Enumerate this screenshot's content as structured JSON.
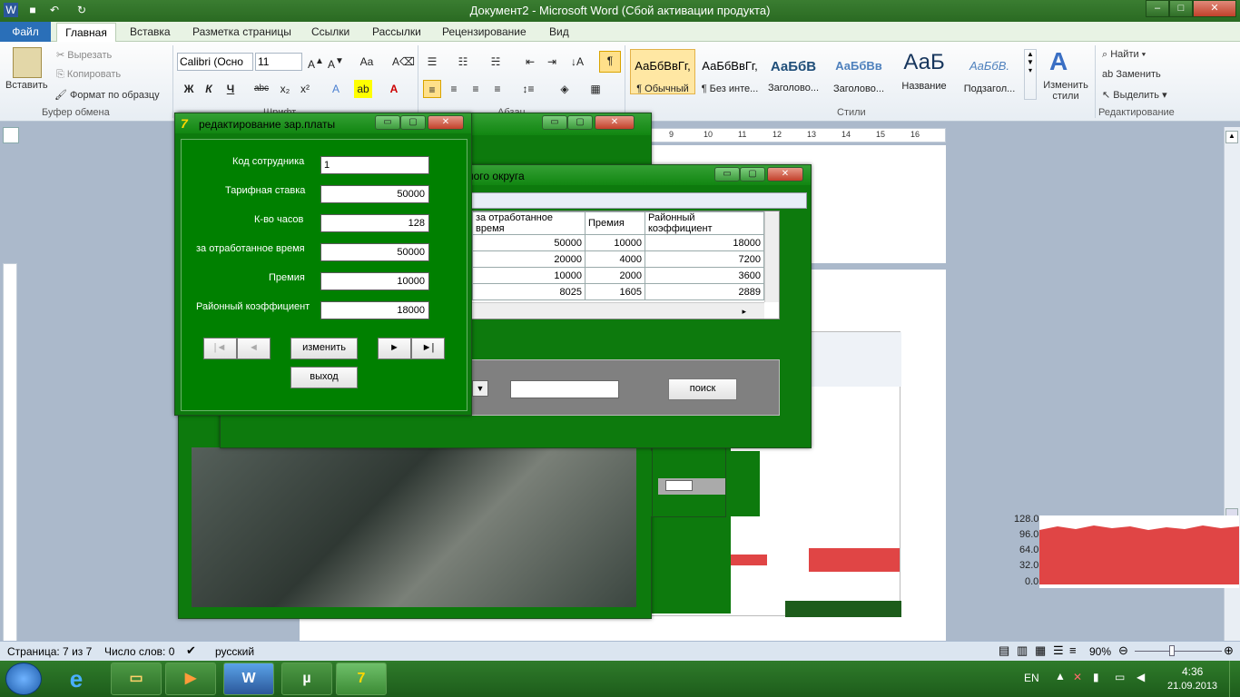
{
  "word": {
    "title": "Документ2 - Microsoft Word (Сбой активации продукта)",
    "tabs": [
      "Файл",
      "Главная",
      "Вставка",
      "Разметка страницы",
      "Ссылки",
      "Рассылки",
      "Рецензирование",
      "Вид"
    ],
    "clipboard": {
      "paste": "Вставить",
      "cut": "Вырезать",
      "copy": "Копировать",
      "format_painter": "Формат по образцу",
      "group": "Буфер обмена"
    },
    "font": {
      "name": "Calibri (Осно",
      "size": "11",
      "group": "Шрифт"
    },
    "paragraph_group": "Абзац",
    "styles": [
      {
        "sample": "АаБбВвГг,",
        "name": "¶ Обычный"
      },
      {
        "sample": "АаБбВвГг,",
        "name": "¶ Без инте..."
      },
      {
        "sample": "АаБбВ",
        "name": "Заголово..."
      },
      {
        "sample": "АаБбВв",
        "name": "Заголово..."
      },
      {
        "sample": "АаБ",
        "name": "Название"
      },
      {
        "sample": "АаБбВ.",
        "name": "Подзагол..."
      }
    ],
    "styles_group": "Стили",
    "change_styles": "Изменить стили",
    "editing": {
      "find": "Найти",
      "replace": "Заменить",
      "select": "Выделить",
      "group": "Редактирование"
    },
    "ruler_marks": [
      "9",
      "10",
      "11",
      "12",
      "13",
      "14",
      "15",
      "16",
      "17"
    ],
    "status": {
      "page": "Страница: 7 из 7",
      "words": "Число слов: 0",
      "lang": "русский",
      "zoom": "90%"
    }
  },
  "edit_window": {
    "title": "редактирование  зар.платы",
    "fields": [
      {
        "label": "Код сотрудника",
        "value": "1"
      },
      {
        "label": "Тарифная ставка",
        "value": "50000"
      },
      {
        "label": "К-во часов",
        "value": "128"
      },
      {
        "label": "за отработанное время",
        "value": "50000"
      },
      {
        "label": "Премия",
        "value": "10000"
      },
      {
        "label": "Районный коэффициент",
        "value": "18000"
      }
    ],
    "buttons": {
      "first": "|◄",
      "prev": "◄",
      "change": "изменить",
      "next": "►",
      "last": "►|",
      "exit": "выход"
    }
  },
  "grid_window": {
    "title": "ного округа",
    "columns": [
      "за отработанное время",
      "Премия",
      "Районный коэффициент"
    ],
    "rows": [
      [
        "50000",
        "10000",
        "18000"
      ],
      [
        "20000",
        "4000",
        "7200"
      ],
      [
        "10000",
        "2000",
        "3600"
      ],
      [
        "8025",
        "1605",
        "2889"
      ]
    ],
    "search_button": "поиск"
  },
  "chart": {
    "yticks": [
      "128.0",
      "96.0",
      "64.0",
      "32.0",
      "0.0"
    ]
  },
  "taskbar": {
    "lang": "EN",
    "time": "4:36",
    "date": "21.09.2013"
  },
  "colors": {
    "app_green": "#0d7a0d",
    "taskbar": "#1d5c1b",
    "word_title": "#2a6a22"
  }
}
